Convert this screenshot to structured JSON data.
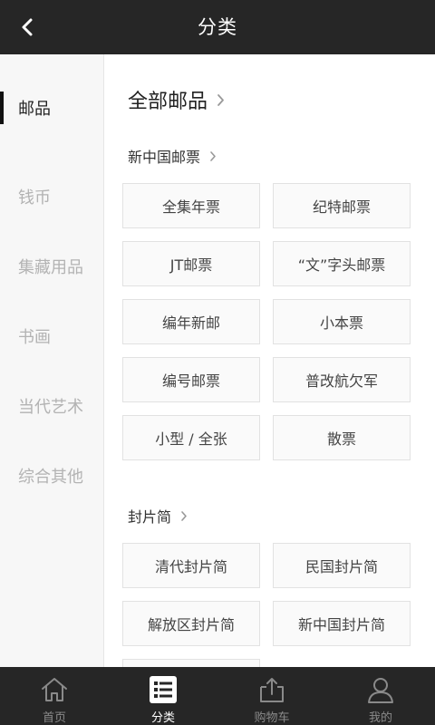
{
  "header": {
    "title": "分类"
  },
  "sidebar": {
    "items": [
      {
        "label": "邮品"
      },
      {
        "label": "钱币"
      },
      {
        "label": "集藏用品"
      },
      {
        "label": "书画"
      },
      {
        "label": "当代艺术"
      },
      {
        "label": "综合其他"
      }
    ]
  },
  "main": {
    "all_title": "全部邮品",
    "sections": [
      {
        "title": "新中国邮票",
        "items": [
          "全集年票",
          "纪特邮票",
          "JT邮票",
          "“文”字头邮票",
          "编年新邮",
          "小本票",
          "编号邮票",
          "普改航欠军",
          "小型 / 全张",
          "散票"
        ]
      },
      {
        "title": "封片简",
        "items": [
          "清代封片简",
          "民国封片简",
          "解放区封片简",
          "新中国封片简",
          ""
        ]
      }
    ]
  },
  "tabbar": {
    "items": [
      {
        "label": "首页",
        "icon": "home-icon"
      },
      {
        "label": "分类",
        "icon": "list-icon"
      },
      {
        "label": "购物车",
        "icon": "cart-icon"
      },
      {
        "label": "我的",
        "icon": "user-icon"
      }
    ]
  }
}
